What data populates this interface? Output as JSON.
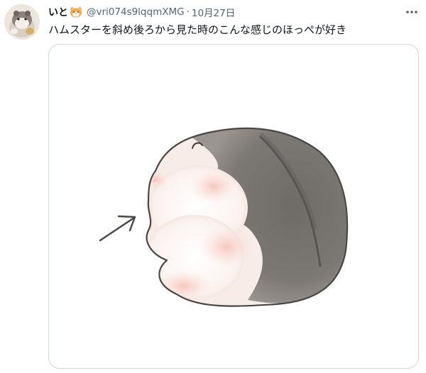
{
  "tweet": {
    "display_name": "いと",
    "name_emoji": "hamster-emoji",
    "handle": "@vri074s9lqqmXMG",
    "separator": "·",
    "date": "10月27日",
    "more_icon": "more-options-icon",
    "text": "ハムスターを斜め後ろから見た時のこんな感じのほっぺが好き",
    "media_alt": "hamster illustration with arrow pointing to cheek"
  },
  "colors": {
    "text_primary": "#0f1419",
    "text_secondary": "#536471",
    "border": "#cfd9de",
    "hamster_grey": "#77736f",
    "cheek_pink": "#f3b6ab"
  }
}
